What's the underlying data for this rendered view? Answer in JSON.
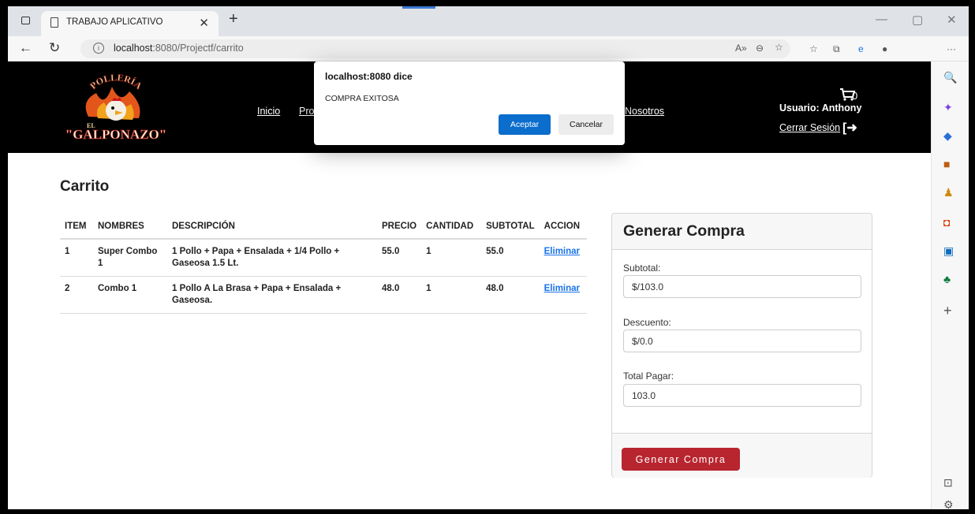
{
  "browser": {
    "tab_title": "TRABAJO APLICATIVO",
    "url_host": "localhost",
    "url_rest": ":8080/Projectf/carrito",
    "colors": {
      "accent": "#0b6dcc"
    }
  },
  "navbar": {
    "logo_top_text": "POLLERÍA",
    "logo_prefix": "EL",
    "logo_main_text": "\"GALPONAZO\"",
    "links": [
      "Inicio",
      "Pro",
      "Nosotros"
    ],
    "cart_count": "0",
    "user_label": "Usuario: Anthony",
    "logout_label": "Cerrar Sesión"
  },
  "dialog": {
    "title": "localhost:8080 dice",
    "message": "COMPRA EXITOSA",
    "ok_label": "Aceptar",
    "cancel_label": "Cancelar"
  },
  "cart": {
    "title": "Carrito",
    "columns": [
      "ITEM",
      "NOMBRES",
      "DESCRIPCIÓN",
      "PRECIO",
      "CANTIDAD",
      "SUBTOTAL",
      "ACCION"
    ],
    "rows": [
      {
        "item": "1",
        "nombre": "Super Combo 1",
        "descripcion": "1 Pollo + Papa + Ensalada + 1/4 Pollo + Gaseosa 1.5 Lt.",
        "precio": "55.0",
        "cantidad": "1",
        "subtotal": "55.0",
        "accion": "Eliminar"
      },
      {
        "item": "2",
        "nombre": "Combo 1",
        "descripcion": "1 Pollo A La Brasa + Papa + Ensalada + Gaseosa.",
        "precio": "48.0",
        "cantidad": "1",
        "subtotal": "48.0",
        "accion": "Eliminar"
      }
    ]
  },
  "summary": {
    "title": "Generar Compra",
    "subtotal_label": "Subtotal:",
    "subtotal_value": "$/103.0",
    "descuento_label": "Descuento:",
    "descuento_value": "$/0.0",
    "total_label": "Total Pagar:",
    "total_value": "103.0",
    "button_label": "Generar Compra",
    "colors": {
      "button": "#b8252f"
    }
  }
}
